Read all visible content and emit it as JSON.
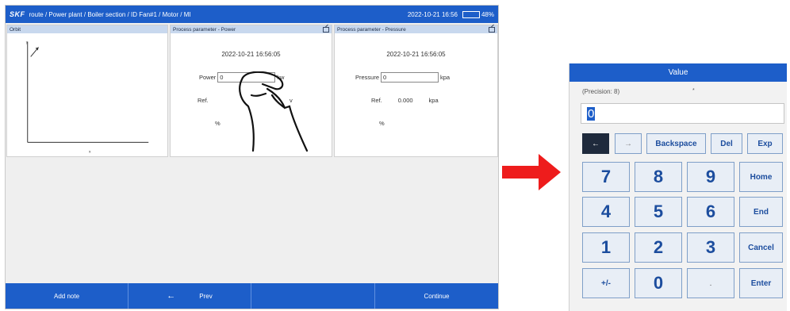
{
  "device": {
    "logo": "SKF",
    "breadcrumb": "route / Power plant / Boiler section / ID Fan#1 / Motor / MI",
    "datetime": "2022-10-21 16:56",
    "battery": {
      "label": "48%",
      "level": 0.48
    },
    "panels": {
      "orbit": {
        "title": "Orbit",
        "y_axis": "y",
        "x_axis": "x"
      },
      "power": {
        "title": "Process parameter - Power",
        "timestamp": "2022-10-21 16:56:05",
        "field_label": "Power",
        "field_value": "0",
        "unit": "kw",
        "ref_label": "Ref.",
        "ref_unit": "v",
        "percent_label": "%"
      },
      "pressure": {
        "title": "Process parameter - Pressure",
        "timestamp": "2022-10-21 16:56:05",
        "field_label": "Pressure",
        "field_value": "0",
        "unit": "kpa",
        "ref_label": "Ref.",
        "ref_value": "0.000",
        "ref_unit": "kpa",
        "percent_label": "%"
      }
    },
    "bottom_bar": {
      "add_note": "Add note",
      "prev_arrow": "←",
      "prev": "Prev",
      "empty": "",
      "continue": "Continue"
    }
  },
  "keypad": {
    "title": "Value",
    "precision": "(Precision: 8)",
    "star": "*",
    "value": "0",
    "keys": {
      "left": "←",
      "right": "→",
      "backspace": "Backspace",
      "del": "Del",
      "exp": "Exp",
      "k7": "7",
      "k8": "8",
      "k9": "9",
      "home": "Home",
      "k4": "4",
      "k5": "5",
      "k6": "6",
      "end": "End",
      "k1": "1",
      "k2": "2",
      "k3": "3",
      "cancel": "Cancel",
      "plusminus": "+/-",
      "k0": "0",
      "dot": ".",
      "enter": "Enter"
    }
  },
  "colors": {
    "brand_blue": "#1d5ec9",
    "arrow_red": "#ee1c1c",
    "key_text": "#1c4d9e"
  },
  "icons": [
    "edit-icon",
    "hand-pointer-icon",
    "arrow-right-icon",
    "battery-icon"
  ]
}
